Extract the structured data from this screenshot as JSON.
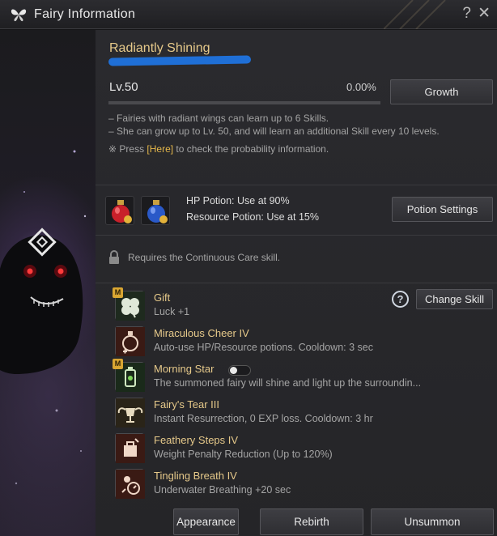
{
  "window": {
    "title": "Fairy Information",
    "help_glyph": "?",
    "close_glyph": "✕"
  },
  "fairy": {
    "name": "Radiantly Shining",
    "level": "Lv.50",
    "exp_percent": "0.00%",
    "exp_progress": 0.0,
    "growth_label": "Growth",
    "desc_lines": [
      "– Fairies with radiant wings can learn up to 6 Skills.",
      "– She can grow up to Lv. 50, and will learn an additional Skill every 10 levels."
    ],
    "probability_prefix": "※ Press ",
    "probability_link": "[Here]",
    "probability_suffix": " to check the probability information."
  },
  "potions": {
    "hp_text": "HP Potion: Use at 90%",
    "resource_text": "Resource Potion: Use at 15%",
    "settings_label": "Potion Settings"
  },
  "care": {
    "locked_text": "Requires the Continuous Care skill."
  },
  "skills": {
    "help_glyph": "?",
    "change_label": "Change Skill",
    "badge_text": "M",
    "items": [
      {
        "name": "Gift",
        "desc": "Luck +1",
        "icon": "clover-icon",
        "badge": true
      },
      {
        "name": "Miraculous Cheer IV",
        "desc": "Auto-use HP/Resource potions. Cooldown: 3 sec",
        "icon": "potion-cheer-icon",
        "badge": false
      },
      {
        "name": "Morning Star",
        "desc": "The summoned fairy will shine and light up the surroundin...",
        "icon": "lantern-icon",
        "badge": true,
        "toggle": true,
        "toggle_on": false
      },
      {
        "name": "Fairy's Tear III",
        "desc": "Instant Resurrection, 0 EXP loss. Cooldown: 3 hr",
        "icon": "winged-chalice-icon",
        "badge": false
      },
      {
        "name": "Feathery Steps IV",
        "desc": "Weight Penalty Reduction (Up to 120%)",
        "icon": "weight-icon",
        "badge": false
      },
      {
        "name": "Tingling Breath IV",
        "desc": "Underwater Breathing +20 sec",
        "icon": "breath-icon",
        "badge": false
      }
    ]
  },
  "footer": {
    "appearance_label": "Appearance",
    "rebirth_label": "Rebirth",
    "unsummon_label": "Unsummon"
  },
  "colors": {
    "accent_gold": "#e6c98a",
    "link_gold": "#e6b84a",
    "badge_gold": "#d9a632",
    "name_scribble_blue": "#1f6fd6"
  }
}
